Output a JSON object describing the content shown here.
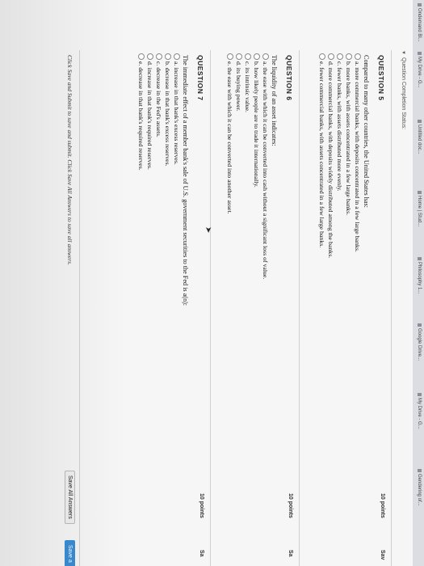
{
  "bookmarks": [
    "Ondemand Bl...",
    "My Drive - G...",
    "Untitled doc...",
    "Home | Stud...",
    "Philosophy 1...",
    "Google Drive...",
    "My Drive - G...",
    "Gendering of..."
  ],
  "status_label": "Question Completion Status:",
  "questions": [
    {
      "title": "QUESTION 5",
      "points": "10 points",
      "save": "Sav",
      "prompt": "Compared to many other countries, the United States has:",
      "options": [
        "a. more commercial banks, with deposits concentrated in a few large banks.",
        "b. more banks, with assets concentrated in a few large banks.",
        "c. fewer banks, with assets distributed more evenly.",
        "d. more commercial banks, with deposits widely distributed among the banks.",
        "e. fewer commercial banks, with assets concentrated in a few large banks."
      ]
    },
    {
      "title": "QUESTION 6",
      "points": "10 points",
      "save": "Sa",
      "prompt": "The liquidity of an asset indicates:",
      "options": [
        "a. the ease with which it can be converted into cash without a significant loss of value.",
        "b. how likely people are to trade it internationally.",
        "c. its intrinsic value.",
        "d. its buying power.",
        "e. the ease with which it can be converted into another asset."
      ]
    },
    {
      "title": "QUESTION 7",
      "points": "10 points",
      "save": "Sa",
      "prompt": "The immediate effect of a member bank's sale of U.S. government securities to the Fed is a(n):",
      "options": [
        "a. increase in that bank's excess reserves.",
        "b. decrease in that bank's excess reserves.",
        "c. decrease in the Fed's assets.",
        "d. increase in that bank's required reserves.",
        "e. decrease in that bank's required reserves."
      ]
    }
  ],
  "footer_note": "Click Save and Submit to save and submit. Click Save All Answers to save all answers.",
  "save_all_label": "Save All Answers",
  "save_submit_label": "Save a"
}
